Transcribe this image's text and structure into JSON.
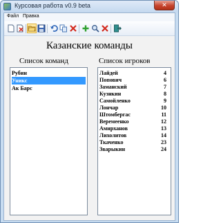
{
  "window": {
    "title": "Курсовая работа v0.9 beta",
    "close_label": "✕"
  },
  "menu": {
    "items": [
      "Файл",
      "Правка"
    ]
  },
  "toolbar": {
    "icons": [
      "new-document-icon",
      "delete-document-icon",
      "open-folder-icon",
      "save-icon",
      "undo-icon",
      "copy-icon",
      "delete-icon",
      "add-icon",
      "search-icon",
      "delete-icon",
      "exit-icon"
    ],
    "selected_icon": "open-folder-icon"
  },
  "main": {
    "title": "Казанские команды",
    "teams_header": "Список команд",
    "players_header": "Список игроков",
    "teams": [
      {
        "name": "Рубин",
        "selected": false
      },
      {
        "name": "Уникс",
        "selected": true
      },
      {
        "name": "Ак Барс",
        "selected": false
      }
    ],
    "players": [
      {
        "name": "Лайдей",
        "number": "4"
      },
      {
        "name": "Попович",
        "number": "6"
      },
      {
        "name": "Заманский",
        "number": "7"
      },
      {
        "name": "Кузнкин",
        "number": "8"
      },
      {
        "name": "Самойленко",
        "number": "9"
      },
      {
        "name": "Лончар",
        "number": "10"
      },
      {
        "name": "Штомбергас",
        "number": "11"
      },
      {
        "name": "Веремеенко",
        "number": "12"
      },
      {
        "name": "Амирханов",
        "number": "13"
      },
      {
        "name": "Лихолитов",
        "number": "14"
      },
      {
        "name": "Ткаченко",
        "number": "23"
      },
      {
        "name": "Зварыкин",
        "number": "24"
      }
    ]
  },
  "colors": {
    "selection": "#3399ff",
    "window_frame": "#c7dcf1",
    "close_button": "#c6432d"
  }
}
